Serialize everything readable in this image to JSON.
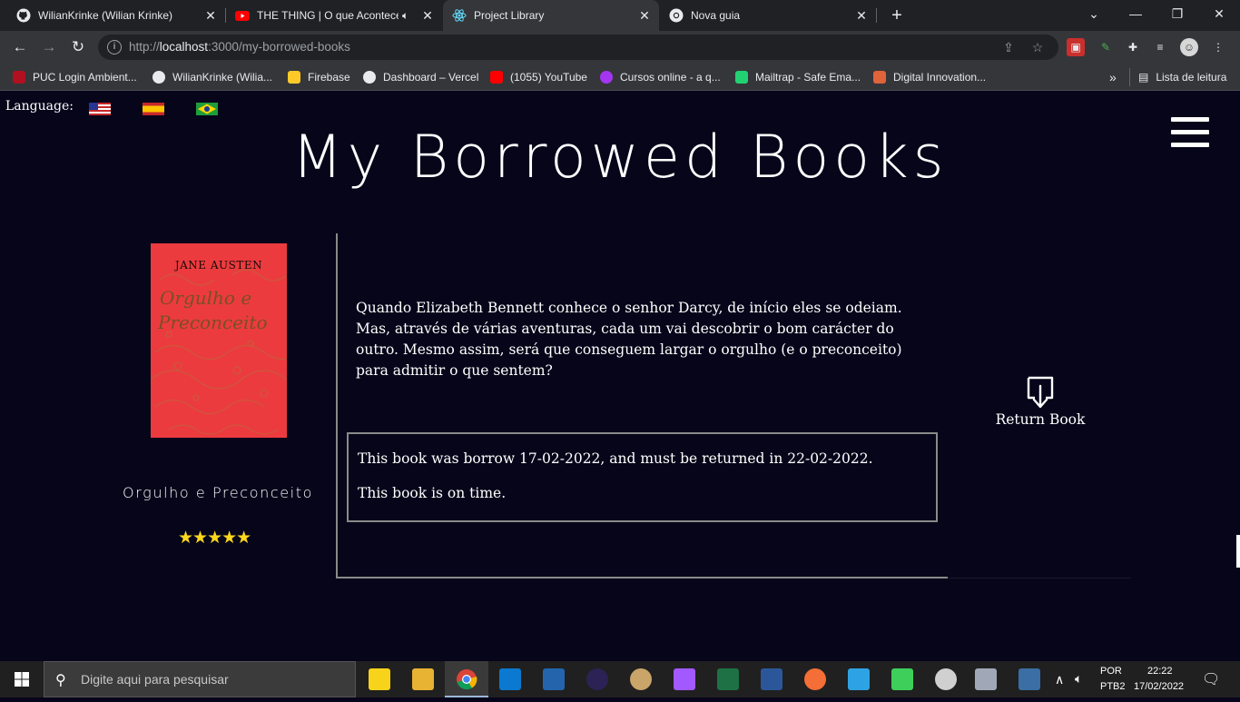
{
  "browser": {
    "tabs": [
      {
        "title": "WilianKrinke (Wilian Krinke)",
        "icon": "github-icon"
      },
      {
        "title": "THE THING | O que Aconteceu",
        "icon": "youtube-icon"
      },
      {
        "title": "Project Library",
        "icon": "react-icon"
      },
      {
        "title": "Nova guia",
        "icon": "chrome-icon"
      }
    ],
    "close_glyph": "✕",
    "new_tab_glyph": "+",
    "url_host": "localhost",
    "url_prefix": "http://",
    "url_rest": ":3000/my-borrowed-books",
    "bookmarks": [
      {
        "label": "PUC Login Ambient...",
        "color": "#b01020"
      },
      {
        "label": "WilianKrinke (Wilia...",
        "color": "#e8eaed"
      },
      {
        "label": "Firebase",
        "color": "#ffca28"
      },
      {
        "label": "Dashboard – Vercel",
        "color": "#e8eaed"
      },
      {
        "label": "(1055) YouTube",
        "color": "#ff0000"
      },
      {
        "label": "Cursos online - a q...",
        "color": "#a435f0"
      },
      {
        "label": "Mailtrap - Safe Ema...",
        "color": "#22d172"
      },
      {
        "label": "Digital Innovation...",
        "color": "#e0633a"
      }
    ],
    "overflow_glyph": "»",
    "reading_list": "Lista de leitura"
  },
  "page": {
    "language_label": "Language:",
    "flags": [
      "us-flag",
      "es-flag",
      "br-flag"
    ],
    "title": "My Borrowed Books",
    "book": {
      "cover_author": "JANE AUSTEN",
      "cover_title_line1": "Orgulho e",
      "cover_title_line2": "Preconceito",
      "title": "Orgulho e Preconceito",
      "rating": 5,
      "stars": "★★★★★",
      "synopsis": "Quando Elizabeth Bennett conhece o senhor Darcy, de início eles se odeiam. Mas, através de várias aventuras, cada um vai descobrir o bom carácter do outro. Mesmo assim, será que conseguem largar o orgulho (e o preconceito) para admitir o que sentem?",
      "borrow_info": "This book was borrow 17-02-2022, and must be returned in 22-02-2022.",
      "status": "This book is on time."
    },
    "return_label": "Return Book"
  },
  "taskbar": {
    "search_placeholder": "Digite aqui para pesquisar",
    "lang_top": "POR",
    "lang_bottom": "PTB2",
    "time": "22:22",
    "date": "17/02/2022"
  }
}
